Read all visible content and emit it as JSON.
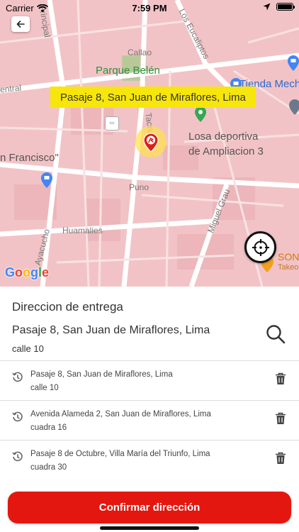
{
  "status_bar": {
    "carrier": "Carrier",
    "time": "7:59 PM"
  },
  "map": {
    "labels": {
      "principal": "Principal",
      "los_eucaliptos": "Los Eucaliptos",
      "callao": "Callao",
      "parque_belen": "Parque Belén",
      "tienda_mech": "Tienda Mech",
      "central": "entral",
      "losa_deportiva_1": "Losa deportiva",
      "losa_deportiva_2": "de Ampliacion 3",
      "tacna": "Tacna",
      "san_francisco": "n Francisco\"",
      "puno": "Puno",
      "miguel_grau": "Miguel Grau",
      "huamalies": "Huamalies",
      "ayacucho": "Ayacucho",
      "son": "SON",
      "takeo": "Takeo"
    },
    "tooltip_address": "Pasaje 8, San Juan de Miraflores, Lima",
    "google_logo": [
      "G",
      "o",
      "o",
      "g",
      "l",
      "e"
    ],
    "google_colors": [
      "#4285F4",
      "#EA4335",
      "#FBBC05",
      "#4285F4",
      "#34A853",
      "#EA4335"
    ]
  },
  "panel": {
    "title": "Direccion de entrega",
    "selected_address": "Pasaje 8, San Juan de Miraflores, Lima",
    "selected_reference": "calle 10",
    "history": [
      {
        "address": "Pasaje 8, San Juan de Miraflores, Lima",
        "reference": "calle 10"
      },
      {
        "address": "Avenida Alameda 2, San Juan de Miraflores, Lima",
        "reference": "cuadra 16"
      },
      {
        "address": "Pasaje 8 de Octubre, Villa María del Triunfo, Lima",
        "reference": "cuadra 30"
      }
    ],
    "confirm_label": "Confirmar dirección"
  },
  "colors": {
    "map_background": "#f2c3c6",
    "tooltip": "#f7e60b",
    "confirm_button": "#e3170f"
  },
  "icons": {
    "back": "arrow-left-icon",
    "search": "search-icon",
    "history": "history-icon",
    "delete": "trash-icon",
    "locate": "crosshair-icon"
  }
}
